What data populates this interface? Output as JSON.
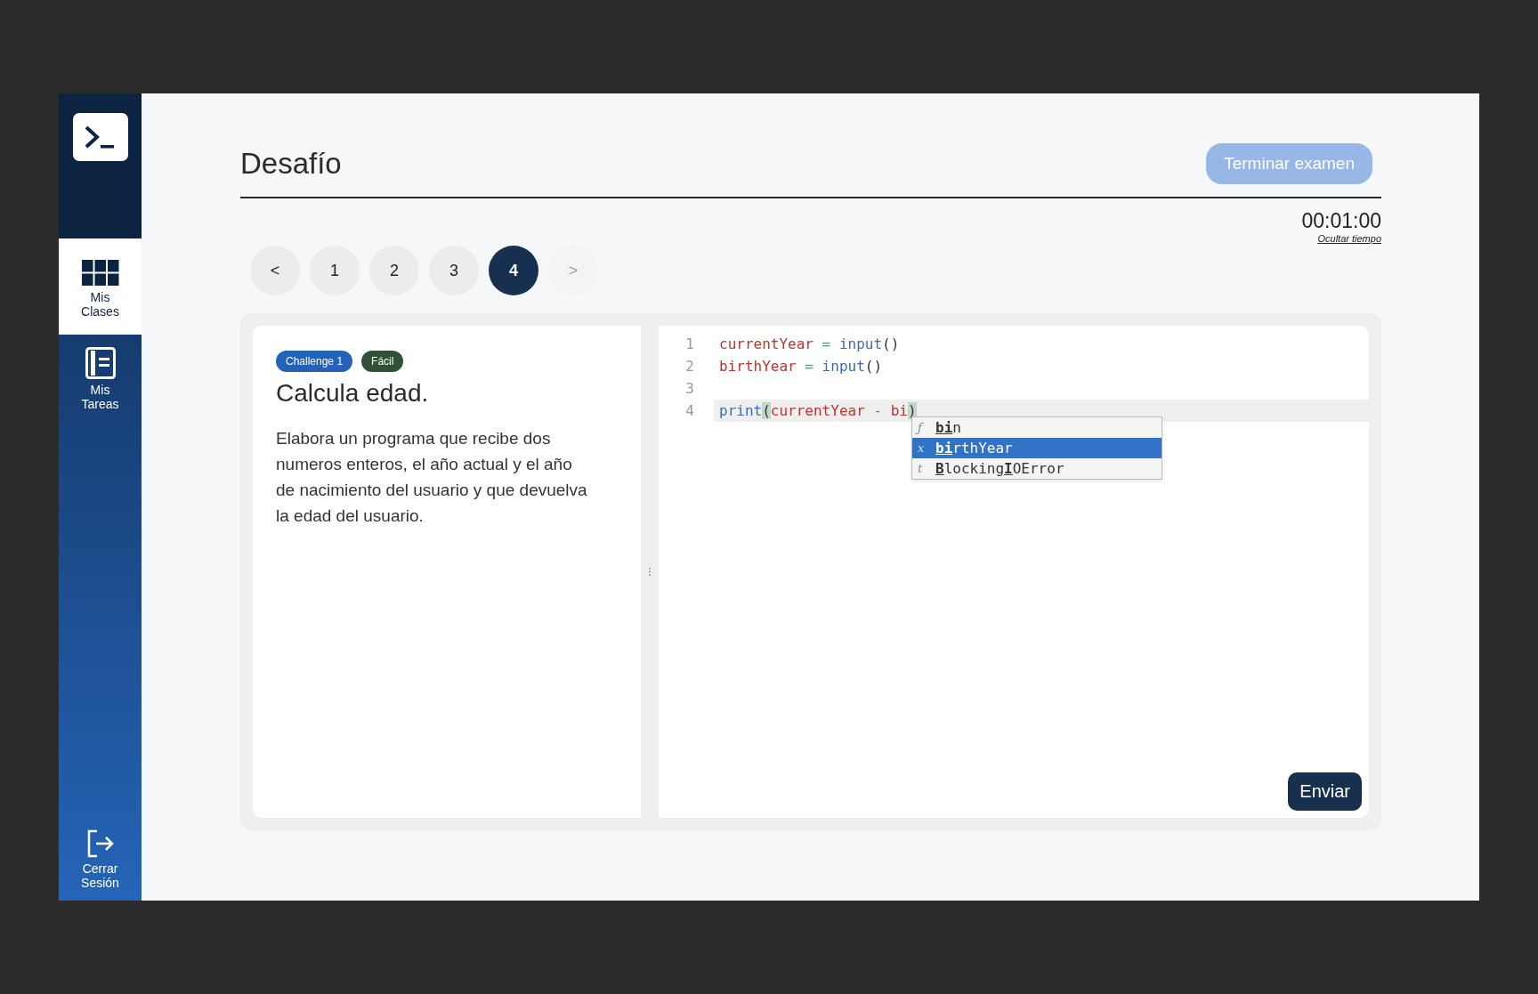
{
  "sidebar": {
    "items": [
      {
        "kind": "classes",
        "label": "Mis Clases",
        "selected": true
      },
      {
        "kind": "tasks",
        "label": "Mis Tareas",
        "selected": false
      }
    ],
    "logout": {
      "label": "Cerrar Sesión"
    }
  },
  "header": {
    "title": "Desafío",
    "finish_button": "Terminar examen",
    "timer": "00:01:00",
    "hide_timer_link": "Ocultar tiempo"
  },
  "pagination": [
    {
      "label": "<",
      "selected": false,
      "disabled": false
    },
    {
      "label": "1",
      "selected": false,
      "disabled": false
    },
    {
      "label": "2",
      "selected": false,
      "disabled": false
    },
    {
      "label": "3",
      "selected": false,
      "disabled": false
    },
    {
      "label": "4",
      "selected": true,
      "disabled": false
    },
    {
      "label": ">",
      "selected": false,
      "disabled": true
    }
  ],
  "challenge": {
    "tags": [
      {
        "label": "Challenge 1",
        "color": "#2461b8"
      },
      {
        "label": "Fácil",
        "color": "#2f5236"
      }
    ],
    "title": "Calcula edad.",
    "description": "Elabora un programa que recibe dos numeros enteros, el año actual y el año de nacimiento del usuario y que devuelva la edad del usuario."
  },
  "editor": {
    "lines": [
      {
        "number": "1",
        "active": false,
        "tokens": [
          {
            "text": "currentYear",
            "kind": "variable"
          },
          {
            "text": " = ",
            "kind": "operator"
          },
          {
            "text": "input",
            "kind": "builtin"
          },
          {
            "text": "()",
            "kind": "punct"
          }
        ]
      },
      {
        "number": "2",
        "active": false,
        "tokens": [
          {
            "text": "birthYear",
            "kind": "variable"
          },
          {
            "text": " = ",
            "kind": "operator"
          },
          {
            "text": "input",
            "kind": "builtin"
          },
          {
            "text": "()",
            "kind": "punct"
          }
        ]
      },
      {
        "number": "3",
        "active": false
      },
      {
        "number": "4",
        "active": true,
        "tokens": [
          {
            "text": "print",
            "kind": "builtin"
          },
          {
            "text": "(",
            "kind": "bracket-match"
          },
          {
            "text": "currentYear",
            "kind": "variable"
          },
          {
            "text": " - ",
            "kind": "operator"
          },
          {
            "text": "bi",
            "kind": "variable"
          },
          {
            "text": ")",
            "kind": "bracket-match"
          }
        ]
      }
    ],
    "autocomplete": [
      {
        "type": "ƒ",
        "selected": false,
        "parts": [
          {
            "text": "bi",
            "underlined": true
          },
          {
            "text": "n",
            "underlined": false
          }
        ]
      },
      {
        "type": "x",
        "selected": true,
        "parts": [
          {
            "text": "bi",
            "underlined": true
          },
          {
            "text": "rthYear",
            "underlined": false
          }
        ]
      },
      {
        "type": "t",
        "selected": false,
        "parts": [
          {
            "text": "B",
            "underlined": true
          },
          {
            "text": "locking",
            "underlined": false
          },
          {
            "text": "I",
            "underlined": true
          },
          {
            "text": "OError",
            "underlined": false
          }
        ]
      }
    ],
    "submit_button": "Enviar"
  }
}
